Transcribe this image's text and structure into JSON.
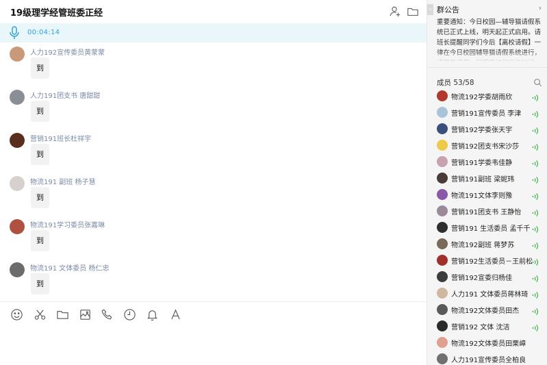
{
  "window": {
    "title": "19级理学经管班委正经"
  },
  "header": {
    "add_member_icon": "add-person-icon",
    "folder_icon": "folder-icon"
  },
  "voice": {
    "time": "00:04:14",
    "icon": "microphone-icon",
    "color": "#2da3d6"
  },
  "messages": [
    {
      "sender": "人力192宣传委员黄蒙蒙",
      "text": "到",
      "avatar_color": "#c99a7a"
    },
    {
      "sender": "人力191团支书 唐甜甜",
      "text": "到",
      "avatar_color": "#8a8f96"
    },
    {
      "sender": "营销191班长杜祥宇",
      "text": "到",
      "avatar_color": "#5a2e1e"
    },
    {
      "sender": "物流191  副班 杨子慧",
      "text": "到",
      "avatar_color": "#d8d0cc"
    },
    {
      "sender": "物流191学习委员张嘉琳",
      "text": "到",
      "avatar_color": "#b05040"
    },
    {
      "sender": "物流191 文体委员 杨仁忠",
      "text": "到",
      "avatar_color": "#6c6c6c"
    }
  ],
  "toolbar": {
    "tools": [
      "emoji-icon",
      "scissors-icon",
      "folder-icon",
      "image-icon",
      "phone-icon",
      "clock-icon",
      "bell-icon",
      "font-icon"
    ]
  },
  "notice": {
    "title": "群公告",
    "collapse_glyph": "‹",
    "chevron": "›",
    "text": "重要通知：今日校园—辅导猫请假系统已正式上线，明天起正式启用。请班长提醒同学们今后【离校请假】一律在今日校园辅导猫请假系统进行，请提前请假，写明离校和返校时间。"
  },
  "members": {
    "title": "成员 53/58",
    "list": [
      {
        "name": "物流192学委胡雨欣",
        "avatar_color": "#b03a2e"
      },
      {
        "name": "营销191宣传委员 李津",
        "avatar_color": "#a9c3d9"
      },
      {
        "name": "营销192学委张天宇",
        "avatar_color": "#3a4f7a"
      },
      {
        "name": "营销192团支书宋沙莎",
        "avatar_color": "#f0c84a"
      },
      {
        "name": "营销191学委韦佳静",
        "avatar_color": "#c7a3b0"
      },
      {
        "name": "营销191副班 梁妮玮",
        "avatar_color": "#4a3a3a"
      },
      {
        "name": "物流191文体李则豫",
        "avatar_color": "#8a5aa8"
      },
      {
        "name": "营销191团支书 王静怡",
        "avatar_color": "#9a8a9a"
      },
      {
        "name": "营销191 生活委员 孟千千",
        "avatar_color": "#2e2e2e"
      },
      {
        "name": "物流192副班 蒋梦苏",
        "avatar_color": "#7a6a5a"
      },
      {
        "name": "营销192生活委员－王前松",
        "avatar_color": "#a0302a"
      },
      {
        "name": "营销192宣委归杨佳",
        "avatar_color": "#3c3c3c"
      },
      {
        "name": "人力191  文体委员蒋林琦",
        "avatar_color": "#d0b8a0"
      },
      {
        "name": "物流192文体委员田杰",
        "avatar_color": "#5a5a5a"
      },
      {
        "name": "营销192 文体 沈洁",
        "avatar_color": "#2a2a2a"
      },
      {
        "name": "物流192文体委员田栗嶂",
        "avatar_color": "#e0a090"
      },
      {
        "name": "人力191宣传委员全柏良",
        "avatar_color": "#707070"
      }
    ],
    "speaker_color": "#3cb043"
  }
}
